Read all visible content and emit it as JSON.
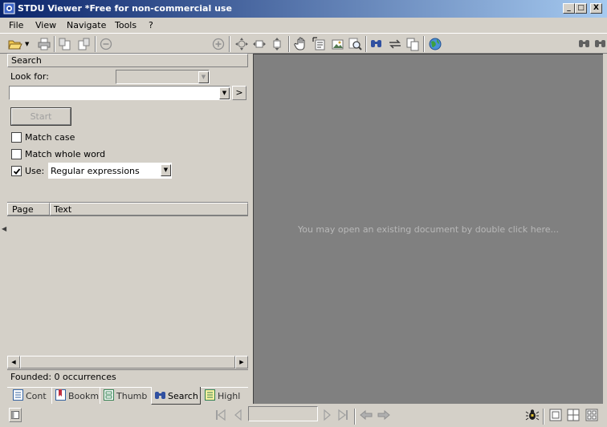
{
  "window": {
    "title": "STDU Viewer *Free for non-commercial use",
    "controls": {
      "minimize": "_",
      "maximize": "□",
      "close": "X"
    }
  },
  "menubar": [
    {
      "label": "File"
    },
    {
      "label": "View"
    },
    {
      "label": "Navigate"
    },
    {
      "label": "Tools"
    },
    {
      "label": "?"
    }
  ],
  "toolbar": {
    "zoom_value": "",
    "page_search_value": "",
    "icons": [
      "open-folder-icon",
      "print-icon",
      "rotate-left-icon",
      "rotate-right-icon",
      "zoom-out-icon",
      "zoom-in-icon",
      "fit-page-icon",
      "fit-width-icon",
      "fit-height-icon",
      "hand-tool-icon",
      "select-text-icon",
      "select-image-icon",
      "magnifier-icon",
      "find-icon",
      "find-replace-icon",
      "copy-icon",
      "internet-icon",
      "find-next-icon"
    ]
  },
  "search_panel": {
    "header": "Search",
    "look_for_label": "Look for:",
    "look_for_value": "",
    "go_button": ">",
    "start_button": "Start",
    "match_case": {
      "label": "Match case",
      "checked": false
    },
    "match_whole_word": {
      "label": "Match whole word",
      "checked": false
    },
    "use": {
      "label": "Use:",
      "checked": true,
      "option": "Regular expressions"
    },
    "results_columns": [
      "Page",
      "Text"
    ],
    "results_status": "Founded: 0 occurrences"
  },
  "document_area": {
    "hint": "You may open an existing document by double click here..."
  },
  "panel_tabs": [
    {
      "label": "Cont",
      "active": false
    },
    {
      "label": "Bookm",
      "active": false
    },
    {
      "label": "Thumb",
      "active": false
    },
    {
      "label": "Search",
      "active": true
    },
    {
      "label": "Highl",
      "active": false
    }
  ],
  "statusbar": {
    "page_field_value": ""
  },
  "colors": {
    "titlebar_start": "#0a246a",
    "titlebar_end": "#a6caf0",
    "face": "#d4d0c8",
    "document_bg": "#808080"
  }
}
